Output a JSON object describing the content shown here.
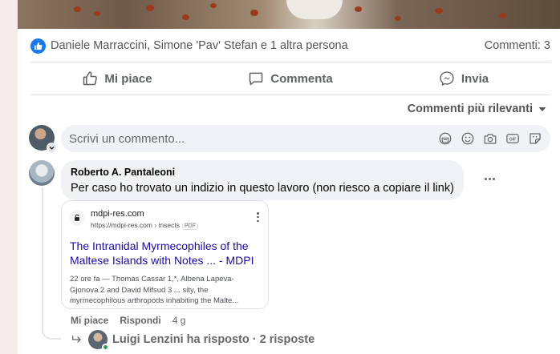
{
  "post": {
    "reactors_text": "Daniele Marraccini, Simone 'Pav' Stefan e 1 altra persona",
    "comments_count": "Commenti: 3"
  },
  "actions": {
    "like": "Mi piace",
    "comment": "Commenta",
    "share": "Invia"
  },
  "sort_label": "Commenti più rilevanti",
  "composer": {
    "placeholder": "Scrivi un commento..."
  },
  "comment": {
    "author": "Roberto A. Pantaleoni",
    "text": "Per caso ho trovato un indizio in questo lavoro (non riesco a copiare il link)",
    "like_label": "Mi piace",
    "reply_label": "Rispondi",
    "time": "4 g"
  },
  "link_preview": {
    "site_name": "mdpi-res.com",
    "site_url": "https://mdpi-res.com › insects",
    "file_tag": "PDF",
    "title": "The Intranidal Myrmecophiles of the Maltese Islands with Notes ... - MDPI",
    "snippet": "22 ore fa — Thomas Cassar 1,*, Albena Lapeva-Gjonova 2 and David Mifsud 3 ... sity, the myrmecophilous arthropods inhabiting the Malte..."
  },
  "replies": {
    "text": "Luigi Lenzini ha risposto · 2 risposte"
  },
  "colors": {
    "brand_blue": "#1877f2",
    "link_blue": "#1a0dab",
    "online_green": "#31a24c"
  }
}
